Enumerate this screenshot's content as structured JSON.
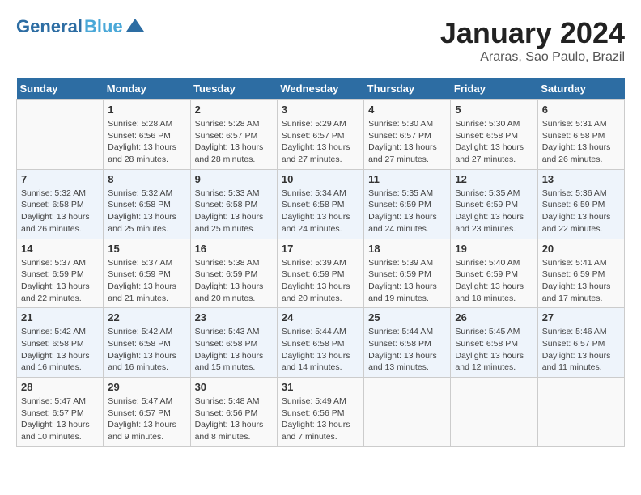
{
  "header": {
    "logo_general": "General",
    "logo_blue": "Blue",
    "month_title": "January 2024",
    "location": "Araras, Sao Paulo, Brazil"
  },
  "days_of_week": [
    "Sunday",
    "Monday",
    "Tuesday",
    "Wednesday",
    "Thursday",
    "Friday",
    "Saturday"
  ],
  "weeks": [
    [
      {
        "day": "",
        "content": ""
      },
      {
        "day": "1",
        "content": "Sunrise: 5:28 AM\nSunset: 6:56 PM\nDaylight: 13 hours\nand 28 minutes."
      },
      {
        "day": "2",
        "content": "Sunrise: 5:28 AM\nSunset: 6:57 PM\nDaylight: 13 hours\nand 28 minutes."
      },
      {
        "day": "3",
        "content": "Sunrise: 5:29 AM\nSunset: 6:57 PM\nDaylight: 13 hours\nand 27 minutes."
      },
      {
        "day": "4",
        "content": "Sunrise: 5:30 AM\nSunset: 6:57 PM\nDaylight: 13 hours\nand 27 minutes."
      },
      {
        "day": "5",
        "content": "Sunrise: 5:30 AM\nSunset: 6:58 PM\nDaylight: 13 hours\nand 27 minutes."
      },
      {
        "day": "6",
        "content": "Sunrise: 5:31 AM\nSunset: 6:58 PM\nDaylight: 13 hours\nand 26 minutes."
      }
    ],
    [
      {
        "day": "7",
        "content": "Sunrise: 5:32 AM\nSunset: 6:58 PM\nDaylight: 13 hours\nand 26 minutes."
      },
      {
        "day": "8",
        "content": "Sunrise: 5:32 AM\nSunset: 6:58 PM\nDaylight: 13 hours\nand 25 minutes."
      },
      {
        "day": "9",
        "content": "Sunrise: 5:33 AM\nSunset: 6:58 PM\nDaylight: 13 hours\nand 25 minutes."
      },
      {
        "day": "10",
        "content": "Sunrise: 5:34 AM\nSunset: 6:58 PM\nDaylight: 13 hours\nand 24 minutes."
      },
      {
        "day": "11",
        "content": "Sunrise: 5:35 AM\nSunset: 6:59 PM\nDaylight: 13 hours\nand 24 minutes."
      },
      {
        "day": "12",
        "content": "Sunrise: 5:35 AM\nSunset: 6:59 PM\nDaylight: 13 hours\nand 23 minutes."
      },
      {
        "day": "13",
        "content": "Sunrise: 5:36 AM\nSunset: 6:59 PM\nDaylight: 13 hours\nand 22 minutes."
      }
    ],
    [
      {
        "day": "14",
        "content": "Sunrise: 5:37 AM\nSunset: 6:59 PM\nDaylight: 13 hours\nand 22 minutes."
      },
      {
        "day": "15",
        "content": "Sunrise: 5:37 AM\nSunset: 6:59 PM\nDaylight: 13 hours\nand 21 minutes."
      },
      {
        "day": "16",
        "content": "Sunrise: 5:38 AM\nSunset: 6:59 PM\nDaylight: 13 hours\nand 20 minutes."
      },
      {
        "day": "17",
        "content": "Sunrise: 5:39 AM\nSunset: 6:59 PM\nDaylight: 13 hours\nand 20 minutes."
      },
      {
        "day": "18",
        "content": "Sunrise: 5:39 AM\nSunset: 6:59 PM\nDaylight: 13 hours\nand 19 minutes."
      },
      {
        "day": "19",
        "content": "Sunrise: 5:40 AM\nSunset: 6:59 PM\nDaylight: 13 hours\nand 18 minutes."
      },
      {
        "day": "20",
        "content": "Sunrise: 5:41 AM\nSunset: 6:59 PM\nDaylight: 13 hours\nand 17 minutes."
      }
    ],
    [
      {
        "day": "21",
        "content": "Sunrise: 5:42 AM\nSunset: 6:58 PM\nDaylight: 13 hours\nand 16 minutes."
      },
      {
        "day": "22",
        "content": "Sunrise: 5:42 AM\nSunset: 6:58 PM\nDaylight: 13 hours\nand 16 minutes."
      },
      {
        "day": "23",
        "content": "Sunrise: 5:43 AM\nSunset: 6:58 PM\nDaylight: 13 hours\nand 15 minutes."
      },
      {
        "day": "24",
        "content": "Sunrise: 5:44 AM\nSunset: 6:58 PM\nDaylight: 13 hours\nand 14 minutes."
      },
      {
        "day": "25",
        "content": "Sunrise: 5:44 AM\nSunset: 6:58 PM\nDaylight: 13 hours\nand 13 minutes."
      },
      {
        "day": "26",
        "content": "Sunrise: 5:45 AM\nSunset: 6:58 PM\nDaylight: 13 hours\nand 12 minutes."
      },
      {
        "day": "27",
        "content": "Sunrise: 5:46 AM\nSunset: 6:57 PM\nDaylight: 13 hours\nand 11 minutes."
      }
    ],
    [
      {
        "day": "28",
        "content": "Sunrise: 5:47 AM\nSunset: 6:57 PM\nDaylight: 13 hours\nand 10 minutes."
      },
      {
        "day": "29",
        "content": "Sunrise: 5:47 AM\nSunset: 6:57 PM\nDaylight: 13 hours\nand 9 minutes."
      },
      {
        "day": "30",
        "content": "Sunrise: 5:48 AM\nSunset: 6:56 PM\nDaylight: 13 hours\nand 8 minutes."
      },
      {
        "day": "31",
        "content": "Sunrise: 5:49 AM\nSunset: 6:56 PM\nDaylight: 13 hours\nand 7 minutes."
      },
      {
        "day": "",
        "content": ""
      },
      {
        "day": "",
        "content": ""
      },
      {
        "day": "",
        "content": ""
      }
    ]
  ]
}
